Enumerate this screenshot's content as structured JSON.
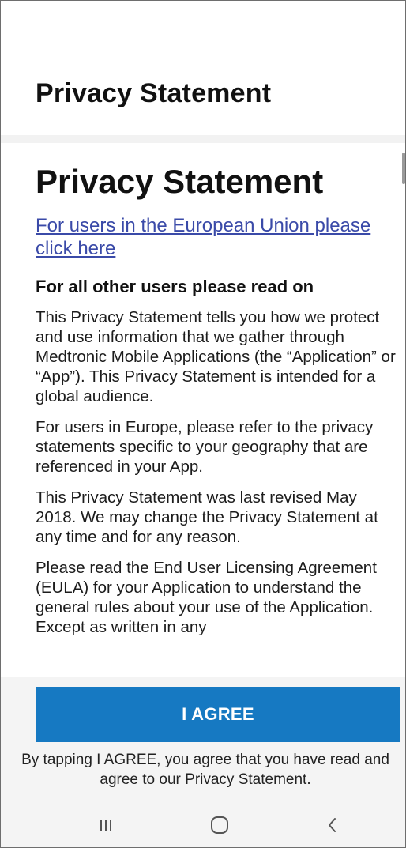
{
  "header": {
    "title": "Privacy Statement"
  },
  "content": {
    "doc_title": "Privacy Statement",
    "eu_link": "For users in the European Union please click here",
    "other_users_heading": "For all other users please read on",
    "paragraphs": [
      "This Privacy Statement tells you how we protect and use information that we gather through Medtronic Mobile Applications (the “Application” or “App”). This Privacy Statement is intended for a global audience.",
      "For users in Europe, please refer to the privacy statements specific to your geography that are referenced in your App.",
      "This Privacy Statement was last revised May 2018. We may change the Privacy Statement at any time and for any reason.",
      "Please read the End User Licensing Agreement (EULA) for your Application to understand the general rules about your use of the Application. Except as written in any"
    ]
  },
  "footer": {
    "agree_label": "I AGREE",
    "agree_note": "By tapping I AGREE, you agree that you have read and agree to our Privacy Statement."
  },
  "nav": {
    "icons": [
      "recent-apps-icon",
      "home-icon",
      "back-icon"
    ]
  },
  "colors": {
    "accent": "#1679c2",
    "link": "#3a4aa8"
  }
}
